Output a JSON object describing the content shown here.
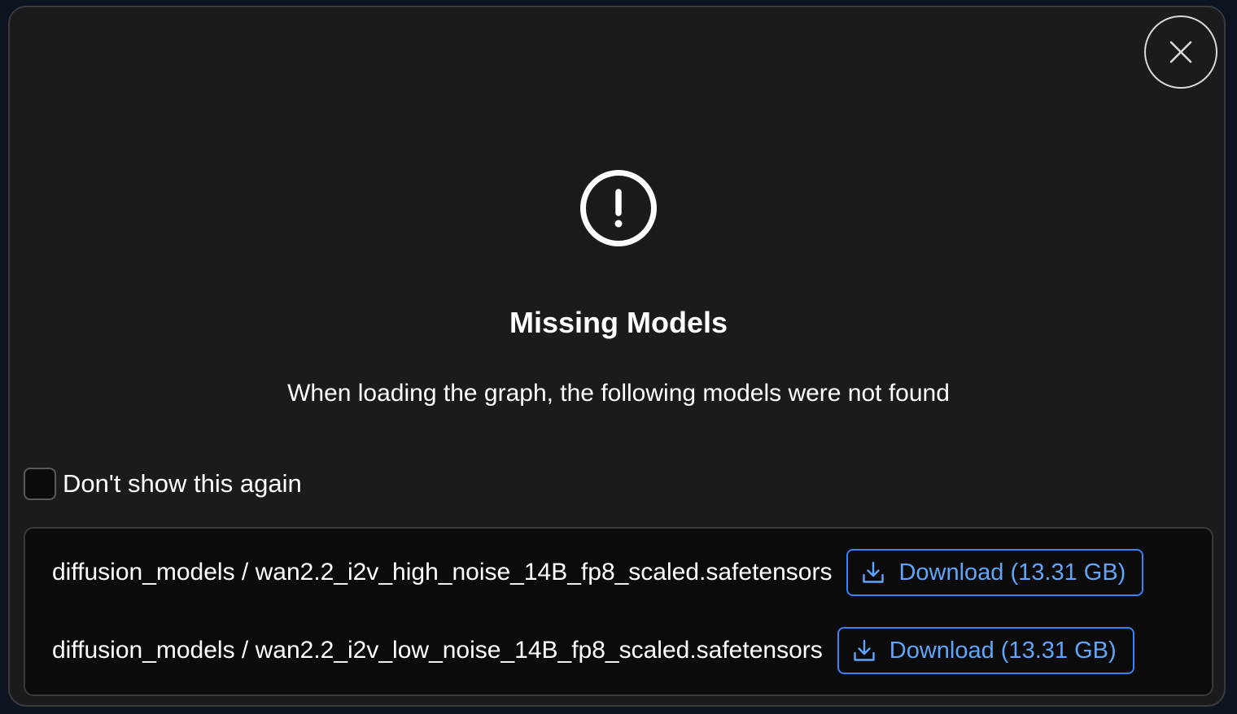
{
  "dialog": {
    "title": "Missing Models",
    "message": "When loading the graph, the following models were not found",
    "close_icon": "close-icon",
    "warning_icon": "exclamation-circle-icon"
  },
  "options": {
    "dont_show_label": "Don't show this again",
    "dont_show_checked": false
  },
  "models": [
    {
      "path": "diffusion_models / wan2.2_i2v_high_noise_14B_fp8_scaled.safetensors",
      "download_label": "Download (13.31 GB)",
      "icon": "download-icon"
    },
    {
      "path": "diffusion_models / wan2.2_i2v_low_noise_14B_fp8_scaled.safetensors",
      "download_label": "Download (13.31 GB)",
      "icon": "download-icon"
    }
  ],
  "colors": {
    "dialog_bg": "#1b1b1d",
    "list_bg": "#0b0b0c",
    "accent": "#3b82f6",
    "accent_text": "#60a5fa",
    "text": "#ffffff"
  }
}
